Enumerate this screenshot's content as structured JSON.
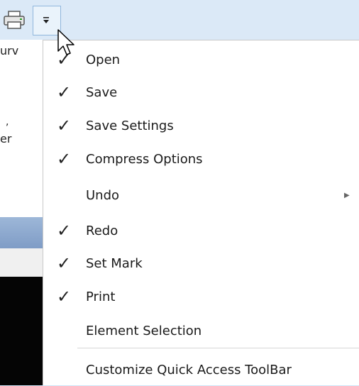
{
  "toolbar": {
    "printer_icon": "printer-icon",
    "dropdown_icon": "customize-dropdown-icon",
    "background_text_1": "urv",
    "background_text_2": "er",
    "background_text_3": ","
  },
  "menu": {
    "items": [
      {
        "label": "Open",
        "checked": true,
        "check_glyph": "✓"
      },
      {
        "label": "Save",
        "checked": true,
        "check_glyph": "✓"
      },
      {
        "label": "Save Settings",
        "checked": true,
        "check_glyph": "✓"
      },
      {
        "label": "Compress Options",
        "checked": true,
        "check_glyph": "✓"
      },
      {
        "label": "Undo",
        "checked": false,
        "check_glyph": "",
        "submenu_glyph": "▶"
      },
      {
        "label": "Redo",
        "checked": true,
        "check_glyph": "✓"
      },
      {
        "label": "Set Mark",
        "checked": true,
        "check_glyph": "✓"
      },
      {
        "label": "Print",
        "checked": true,
        "check_glyph": "✓"
      },
      {
        "label": "Element Selection",
        "checked": false,
        "check_glyph": ""
      },
      {
        "label": "Customize Quick Access ToolBar",
        "checked": false,
        "check_glyph": ""
      }
    ]
  }
}
